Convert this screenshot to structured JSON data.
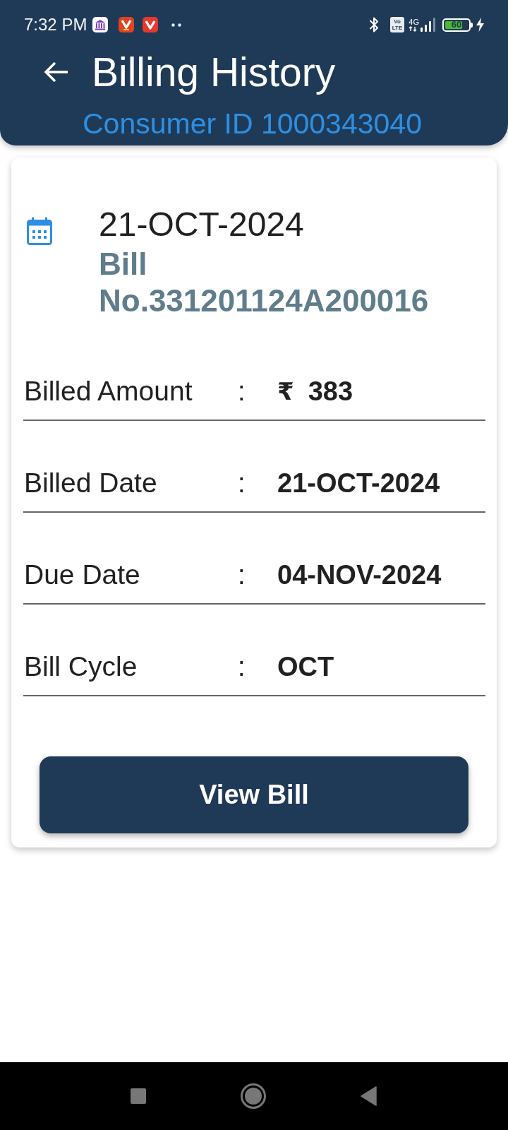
{
  "status_bar": {
    "time": "7:32 PM",
    "volte": [
      "Vo",
      "LTE"
    ],
    "network": "4G",
    "battery": "60"
  },
  "header": {
    "title": "Billing History",
    "subtitle": "Consumer ID 1000343040"
  },
  "bill": {
    "date": "21-OCT-2024",
    "bill_number": "Bill No.331201124A200016",
    "details": [
      {
        "label": "Billed Amount",
        "separator": ":",
        "currency": "₹",
        "value": "383"
      },
      {
        "label": "Billed Date",
        "separator": ":",
        "value": "21-OCT-2024"
      },
      {
        "label": "Due Date",
        "separator": ":",
        "value": "04-NOV-2024"
      },
      {
        "label": "Bill Cycle",
        "separator": ":",
        "value": "OCT"
      }
    ],
    "button": "View Bill"
  }
}
